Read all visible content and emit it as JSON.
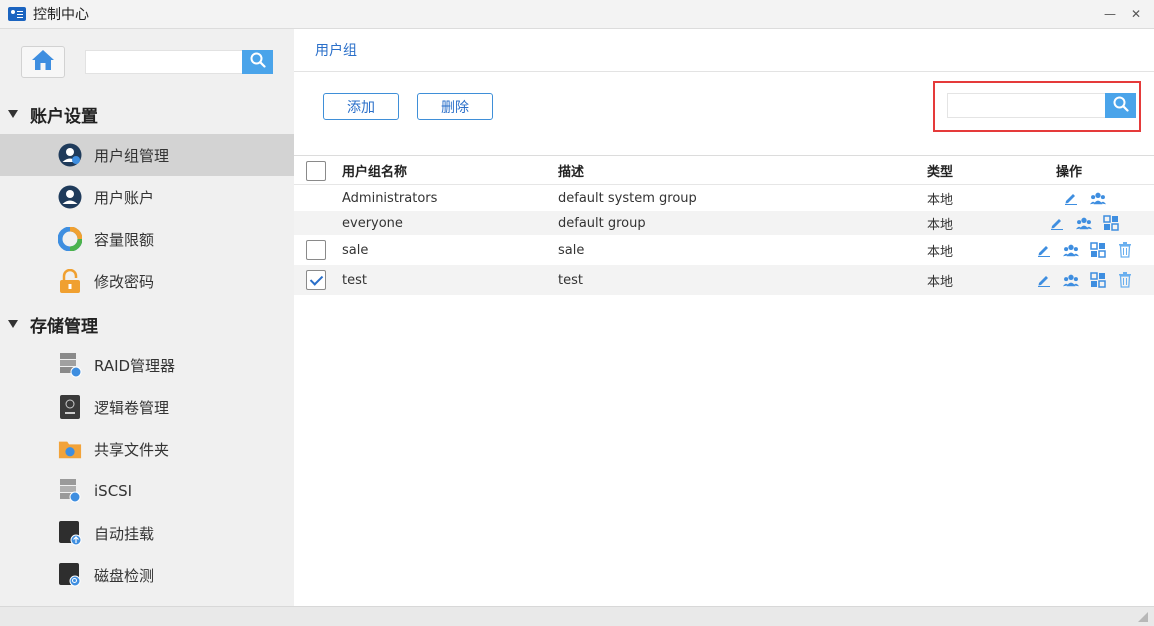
{
  "window": {
    "title": "控制中心",
    "minimize_glyph": "—",
    "close_glyph": "✕"
  },
  "sidebar": {
    "search_placeholder": "",
    "groups": [
      {
        "title": "账户设置",
        "items": [
          {
            "label": "用户组管理",
            "icon": "user-group-icon",
            "active": true
          },
          {
            "label": "用户账户",
            "icon": "user-account-icon",
            "active": false
          },
          {
            "label": "容量限额",
            "icon": "quota-pie-icon",
            "active": false
          },
          {
            "label": "修改密码",
            "icon": "lock-icon",
            "active": false
          }
        ]
      },
      {
        "title": "存储管理",
        "items": [
          {
            "label": "RAID管理器",
            "icon": "raid-manager-icon"
          },
          {
            "label": "逻辑卷管理",
            "icon": "lvm-icon"
          },
          {
            "label": "共享文件夹",
            "icon": "shared-folder-icon"
          },
          {
            "label": "iSCSI",
            "icon": "iscsi-icon"
          },
          {
            "label": "自动挂载",
            "icon": "auto-mount-icon"
          },
          {
            "label": "磁盘检测",
            "icon": "disk-check-icon"
          }
        ]
      }
    ]
  },
  "main": {
    "breadcrumb": "用户组",
    "buttons": {
      "add": "添加",
      "delete": "删除"
    },
    "search_placeholder": "",
    "table": {
      "columns": {
        "name": "用户组名称",
        "desc": "描述",
        "type": "类型",
        "ops": "操作"
      },
      "rows": [
        {
          "name": "Administrators",
          "desc": "default system group",
          "type": "本地",
          "has_checkbox": false,
          "checked": false,
          "ops": [
            "edit-icon",
            "members-icon"
          ]
        },
        {
          "name": "everyone",
          "desc": "default group",
          "type": "本地",
          "has_checkbox": false,
          "checked": false,
          "ops": [
            "edit-icon",
            "members-icon",
            "permissions-icon"
          ]
        },
        {
          "name": "sale",
          "desc": "sale",
          "type": "本地",
          "has_checkbox": true,
          "checked": false,
          "ops": [
            "edit-icon",
            "members-icon",
            "permissions-icon",
            "trash-icon"
          ]
        },
        {
          "name": "test",
          "desc": "test",
          "type": "本地",
          "has_checkbox": true,
          "checked": true,
          "ops": [
            "edit-icon",
            "members-icon",
            "permissions-icon",
            "trash-icon"
          ]
        }
      ]
    }
  },
  "colors": {
    "accent": "#2a6fc9",
    "search_button": "#4aa4ea",
    "highlight": "#e53a3a",
    "active_nav": "#d3d3d3"
  }
}
